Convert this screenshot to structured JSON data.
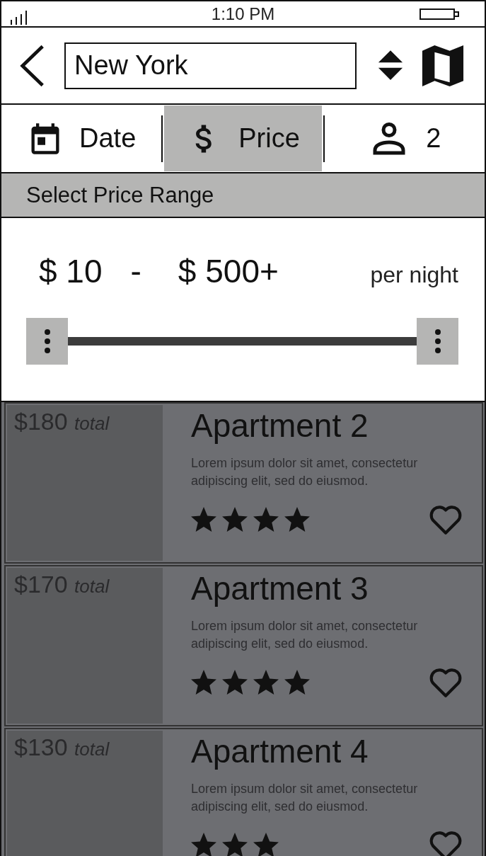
{
  "status_bar": {
    "time": "1:10 PM"
  },
  "search": {
    "value": "New York"
  },
  "tabs": [
    {
      "kind": "date",
      "label": "Date",
      "selected": false
    },
    {
      "kind": "price",
      "label": "Price",
      "selected": true
    },
    {
      "kind": "guests",
      "label": "2",
      "selected": false
    }
  ],
  "price_filter": {
    "title": "Select Price Range",
    "min": "$ 10",
    "separator": "-",
    "max": "$ 500+",
    "unit": "per night"
  },
  "listings": [
    {
      "price": "$180",
      "price_unit": "total",
      "title": "Apartment 2",
      "description": "Lorem ipsum dolor sit amet, consectetur adipiscing elit, sed do eiusmod.",
      "stars": 4,
      "favorite": false
    },
    {
      "price": "$170",
      "price_unit": "total",
      "title": "Apartment 3",
      "description": "Lorem ipsum dolor sit amet, consectetur adipiscing elit, sed do eiusmod.",
      "stars": 4,
      "favorite": false
    },
    {
      "price": "$130",
      "price_unit": "total",
      "title": "Apartment 4",
      "description": "Lorem ipsum dolor sit amet, consectetur adipiscing elit, sed do eiusmod.",
      "stars": 3,
      "favorite": false
    }
  ]
}
